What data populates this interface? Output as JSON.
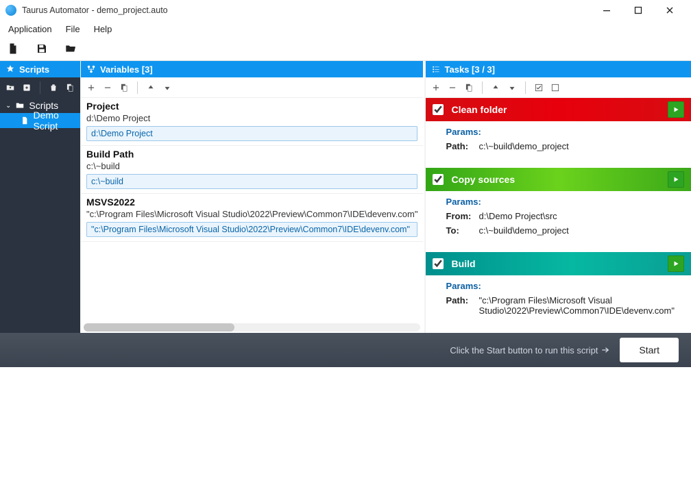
{
  "window": {
    "title": "Taurus Automator - demo_project.auto"
  },
  "menubar": {
    "items": [
      "Application",
      "File",
      "Help"
    ]
  },
  "toolbar": {
    "new": "new-file-icon",
    "save": "save-icon",
    "open": "open-folder-icon"
  },
  "scripts": {
    "header": "Scripts",
    "tree": {
      "root": "Scripts",
      "children": [
        {
          "label": "Demo Script",
          "selected": true
        }
      ]
    }
  },
  "variables": {
    "header": "Variables  [3]",
    "items": [
      {
        "name": "Project",
        "value": "d:\\Demo Project",
        "edit": "d:\\Demo Project"
      },
      {
        "name": "Build Path",
        "value": "c:\\~build",
        "edit": "c:\\~build"
      },
      {
        "name": "MSVS2022",
        "value": "\"c:\\Program Files\\Microsoft Visual Studio\\2022\\Preview\\Common7\\IDE\\devenv.com\"",
        "edit": "\"c:\\Program Files\\Microsoft Visual Studio\\2022\\Preview\\Common7\\IDE\\devenv.com\""
      }
    ]
  },
  "tasks": {
    "header": "Tasks  [3 / 3]",
    "items": [
      {
        "title": "Clean folder",
        "checked": true,
        "color": "red",
        "paramsHeader": "Params:",
        "params": [
          {
            "label": "Path:",
            "value": "c:\\~build\\demo_project"
          }
        ]
      },
      {
        "title": "Copy sources",
        "checked": true,
        "color": "green",
        "paramsHeader": "Params:",
        "params": [
          {
            "label": "From:",
            "value": "d:\\Demo Project\\src"
          },
          {
            "label": "To:",
            "value": "c:\\~build\\demo_project"
          }
        ]
      },
      {
        "title": "Build",
        "checked": true,
        "color": "teal",
        "paramsHeader": "Params:",
        "params": [
          {
            "label": "Path:",
            "value": "\"c:\\Program Files\\Microsoft Visual Studio\\2022\\Preview\\Common7\\IDE\\devenv.com\""
          }
        ]
      }
    ]
  },
  "runbar": {
    "hint": "Click the Start button to run this script",
    "start": "Start"
  }
}
